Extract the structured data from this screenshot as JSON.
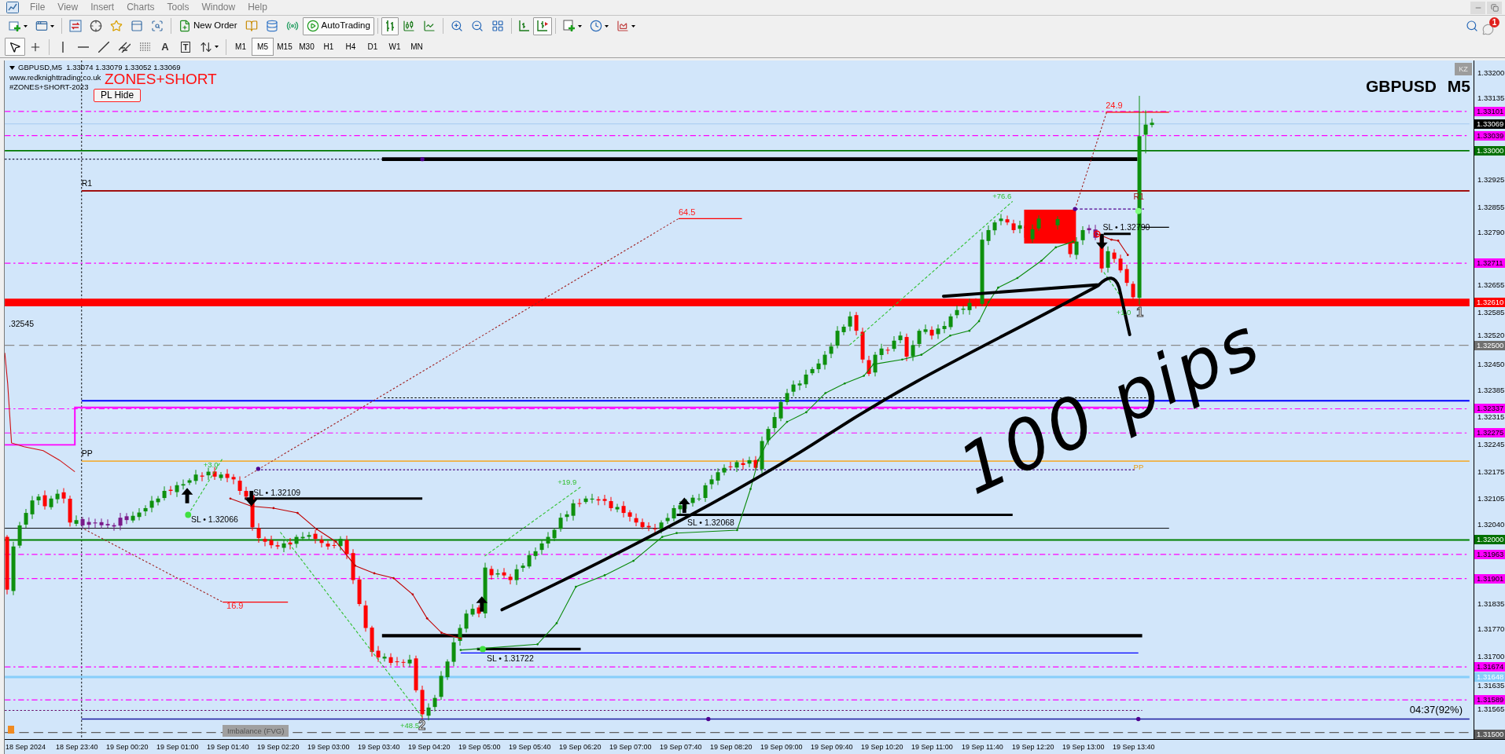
{
  "menu": [
    "File",
    "View",
    "Insert",
    "Charts",
    "Tools",
    "Window",
    "Help"
  ],
  "toolbar": {
    "new_order": "New Order",
    "autotrading": {
      "label": "AutoTrading",
      "on": true
    },
    "chart_types": [
      {
        "kind": "bars",
        "selected": true
      },
      {
        "kind": "candles",
        "selected": false
      },
      {
        "kind": "line",
        "selected": false
      }
    ],
    "auto_scroll": {
      "on": true
    },
    "drawing_tools": [
      {
        "kind": "cursor",
        "selected": true
      },
      {
        "kind": "crosshair",
        "selected": false
      },
      {
        "kind": "vertical_line",
        "selected": false
      },
      {
        "kind": "horizontal_line",
        "selected": false
      },
      {
        "kind": "trend_line",
        "selected": false
      },
      {
        "kind": "channel",
        "selected": false
      },
      {
        "kind": "fibonacci",
        "selected": false
      },
      {
        "kind": "text",
        "label": "A",
        "selected": false
      },
      {
        "kind": "text_label",
        "label": "T",
        "selected": false
      },
      {
        "kind": "arrows",
        "selected": false
      }
    ],
    "timeframes": [
      {
        "label": "M1",
        "selected": false
      },
      {
        "label": "M5",
        "selected": true
      },
      {
        "label": "M15",
        "selected": false
      },
      {
        "label": "M30",
        "selected": false
      },
      {
        "label": "H1",
        "selected": false
      },
      {
        "label": "H4",
        "selected": false
      },
      {
        "label": "D1",
        "selected": false
      },
      {
        "label": "W1",
        "selected": false
      },
      {
        "label": "MN",
        "selected": false
      }
    ],
    "notification_count": "1"
  },
  "chart": {
    "header": {
      "symbol_line": "GBPUSD,M5  1.33074 1.33079 1.33052 1.33069",
      "website": "www.redknighttrading.co.uk",
      "indicator_id": "#ZONES+SHORT-2023"
    },
    "indicator_title": "ZONES+SHORT",
    "pl_button": "PL Hide",
    "symbol": "GBPUSD",
    "timeframe": "M5",
    "badge": "KZ",
    "labels": [
      {
        "text": "R1",
        "kind": "level_name"
      },
      {
        "text": ".32545",
        "kind": "price"
      },
      {
        "text": "PP",
        "kind": "level_name"
      },
      {
        "text": "+3.0",
        "kind": "profit"
      },
      {
        "text": "SL • 1.32109",
        "kind": "stop_loss"
      },
      {
        "text": "SL • 1.32066",
        "kind": "stop_loss"
      },
      {
        "text": "16.9",
        "kind": "distance"
      },
      {
        "text": "+19.9",
        "kind": "profit"
      },
      {
        "text": "64.5",
        "kind": "distance"
      },
      {
        "text": "SL • 1.32068",
        "kind": "stop_loss"
      },
      {
        "text": "SL • 1.31722",
        "kind": "stop_loss"
      },
      {
        "text": "+48.5",
        "kind": "profit"
      },
      {
        "text": "+76.6",
        "kind": "profit"
      },
      {
        "text": "SL • 1.32790",
        "kind": "stop_loss"
      },
      {
        "text": "R1",
        "kind": "resistance"
      },
      {
        "text": "24.9",
        "kind": "distance"
      },
      {
        "text": "+1.0",
        "kind": "profit"
      },
      {
        "text": "1",
        "kind": "marker"
      },
      {
        "text": "PP",
        "kind": "pivot"
      },
      {
        "text": "2",
        "kind": "marker"
      }
    ],
    "handwritten_note": "100 pips",
    "imbalance_label": "Imbalance (FVG)",
    "countdown": "04:37(92%)"
  },
  "price_axis": {
    "ticks": [
      "1.33200",
      "1.33135",
      "1.32925",
      "1.32855",
      "1.32790",
      "1.32655",
      "1.32585",
      "1.32520",
      "1.32450",
      "1.32385",
      "1.32315",
      "1.32245",
      "1.32175",
      "1.32105",
      "1.32040",
      "1.31835",
      "1.31770",
      "1.31700",
      "1.31635",
      "1.31565"
    ],
    "tags": [
      {
        "text": "1.33101",
        "color": "#ff00ff"
      },
      {
        "text": "1.33069",
        "color": "#000000"
      },
      {
        "text": "1.33039",
        "color": "#ff00ff"
      },
      {
        "text": "1.33000",
        "color": "#007000"
      },
      {
        "text": "1.32711",
        "color": "#ff00ff"
      },
      {
        "text": "1.32610",
        "color": "#ff0000"
      },
      {
        "text": "1.32500",
        "color": "#707070"
      },
      {
        "text": "1.32337",
        "color": "#ff00ff"
      },
      {
        "text": "1.32275",
        "color": "#ff00ff"
      },
      {
        "text": "1.32000",
        "color": "#007000"
      },
      {
        "text": "1.31963",
        "color": "#ff00ff"
      },
      {
        "text": "1.31901",
        "color": "#ff00ff"
      },
      {
        "text": "1.31674",
        "color": "#ff00ff"
      },
      {
        "text": "1.31648",
        "color": "#87cefa"
      },
      {
        "text": "1.31589",
        "color": "#ff00ff"
      },
      {
        "text": "1.31500",
        "color": "#5a5a5a"
      }
    ]
  },
  "time_axis": {
    "labels": [
      "18 Sep 2024",
      "18 Sep 23:40",
      "19 Sep 00:20",
      "19 Sep 01:00",
      "19 Sep 01:40",
      "19 Sep 02:20",
      "19 Sep 03:00",
      "19 Sep 03:40",
      "19 Sep 04:20",
      "19 Sep 05:00",
      "19 Sep 05:40",
      "19 Sep 06:20",
      "19 Sep 07:00",
      "19 Sep 07:40",
      "19 Sep 08:20",
      "19 Sep 09:00",
      "19 Sep 09:40",
      "19 Sep 10:20",
      "19 Sep 11:00",
      "19 Sep 11:40",
      "19 Sep 12:20",
      "19 Sep 13:00",
      "19 Sep 13:40"
    ]
  }
}
